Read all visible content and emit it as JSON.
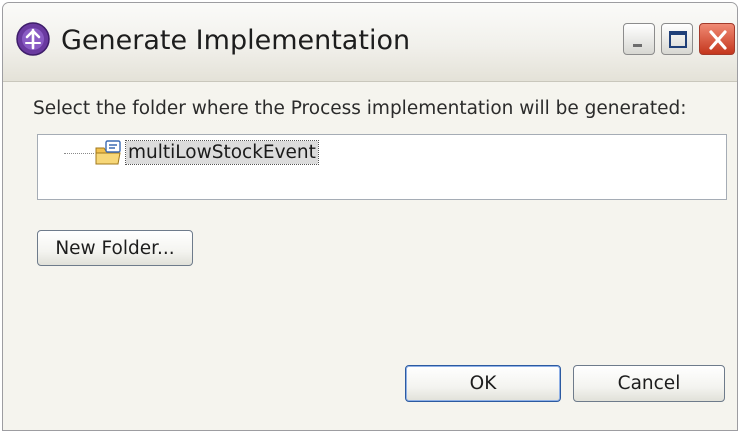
{
  "window": {
    "title": "Generate Implementation",
    "icon": "process-icon"
  },
  "dialog": {
    "instruction": "Select the folder where the Process implementation will be generated:"
  },
  "tree": {
    "items": [
      {
        "label": "multiLowStockEvent",
        "icon": "folder-icon",
        "selected": true
      }
    ]
  },
  "buttons": {
    "new_folder": "New Folder...",
    "ok": "OK",
    "cancel": "Cancel"
  },
  "colors": {
    "dialog_bg": "#f5f4ee",
    "close_button": "#c4361d",
    "app_icon": "#6a3aa0"
  }
}
